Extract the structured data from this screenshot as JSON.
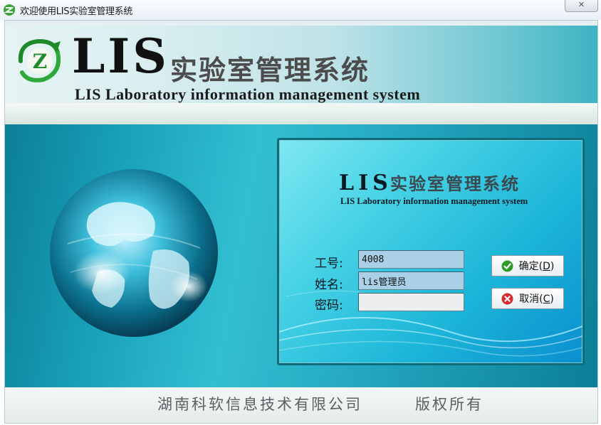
{
  "window": {
    "title": "欢迎使用LIS实验室管理系统",
    "close_label": "✕"
  },
  "header": {
    "logo_letter": "Z",
    "brand": "LIS",
    "cn_title": "实验室管理系统",
    "en_title": "LIS  Laboratory information management system"
  },
  "login": {
    "brand": "LIS",
    "cn_title": "实验室管理系统",
    "en_title": "LIS  Laboratory information management system",
    "fields": {
      "id_label": "工号:",
      "id_value": "4008",
      "name_label": "姓名:",
      "name_value": "lis管理员",
      "password_label": "密码:",
      "password_value": ""
    },
    "confirm": {
      "text": "确定(",
      "key": "D",
      "tail": ")"
    },
    "cancel": {
      "text": "取消(",
      "key": "C",
      "tail": ")"
    }
  },
  "footer": {
    "company": "湖南科软信息技术有限公司",
    "rights": "版权所有"
  },
  "colors": {
    "panel_border": "#0e6b7c",
    "input_readonly": "#a9d0e6",
    "confirm_icon": "#2f9a2a",
    "cancel_icon": "#d42a2a"
  },
  "icons": {
    "app": "z-logo-icon",
    "confirm": "check-circle-icon",
    "cancel": "x-circle-icon",
    "close": "close-icon"
  }
}
